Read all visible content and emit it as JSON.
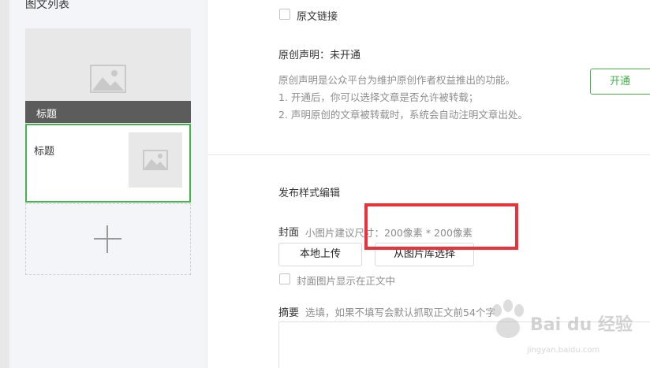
{
  "article_list": {
    "title": "图文列表",
    "cover_card": {
      "title": "标题",
      "image": "image-placeholder-icon"
    },
    "sub_card": {
      "title": "标题",
      "image": "image-placeholder-icon"
    },
    "add_button": {
      "icon": "plus-icon"
    }
  },
  "original_link": {
    "label": "原文链接",
    "checked": false
  },
  "original_declaration": {
    "title": "原创声明：未开通",
    "description": "原创声明是公众平台为维护原创作者权益推出的功能。",
    "items": [
      "1. 开通后，你可以选择文章是否允许被转载；",
      "2. 声明原创的文章被转载时，系统会自动注明文章出处。"
    ],
    "open_button": "开通"
  },
  "publish_style": {
    "title": "发布样式编辑",
    "cover": {
      "label": "封面",
      "hint": "小图片建议尺寸：200像素 * 200像素",
      "upload_local_button": "本地上传",
      "choose_library_button": "从图片库选择",
      "show_in_body_label": "封面图片显示在正文中",
      "show_in_body_checked": false
    },
    "summary": {
      "label": "摘要",
      "hint": "选填，如果不填写会默认抓取正文前54个字",
      "value": ""
    }
  },
  "watermark": {
    "brand": "Bai du 经验",
    "url": "jingyan.baidu.com"
  },
  "colors": {
    "accent_green": "#44b549",
    "highlight_red": "#e8333b",
    "panel_bg": "#f4f5f9",
    "dark_bar": "#5c5c5c"
  }
}
